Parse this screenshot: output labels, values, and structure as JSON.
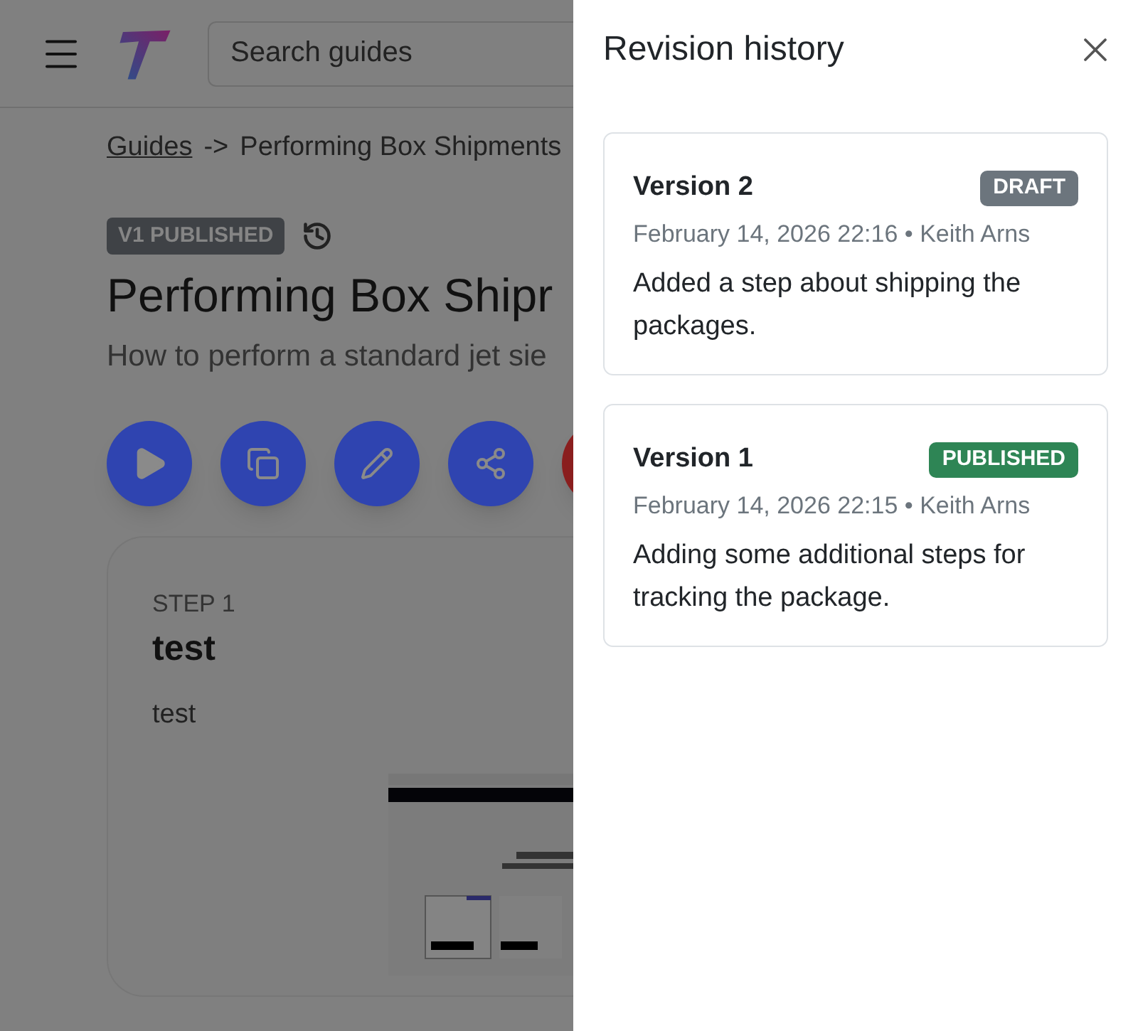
{
  "header": {
    "search": {
      "placeholder": "Search guides"
    }
  },
  "breadcrumb": {
    "link": "Guides",
    "separator": "->",
    "current": "Performing Box Shipments"
  },
  "guide": {
    "status_badge": "V1 PUBLISHED",
    "title": "Performing Box Shipr",
    "subtitle": "How to perform a standard jet sie"
  },
  "step": {
    "label": "STEP 1",
    "title": "test",
    "body": "test"
  },
  "drawer": {
    "title": "Revision history",
    "revisions": [
      {
        "title": "Version 2",
        "status": "DRAFT",
        "kind": "draft",
        "meta": "February 14, 2026 22:16 • Keith Arns",
        "note": "Added a step about shipping the packages."
      },
      {
        "title": "Version 1",
        "status": "PUBLISHED",
        "kind": "published",
        "meta": "February 14, 2026 22:15 • Keith Arns",
        "note": "Adding some additional steps for tracking the package."
      }
    ]
  }
}
